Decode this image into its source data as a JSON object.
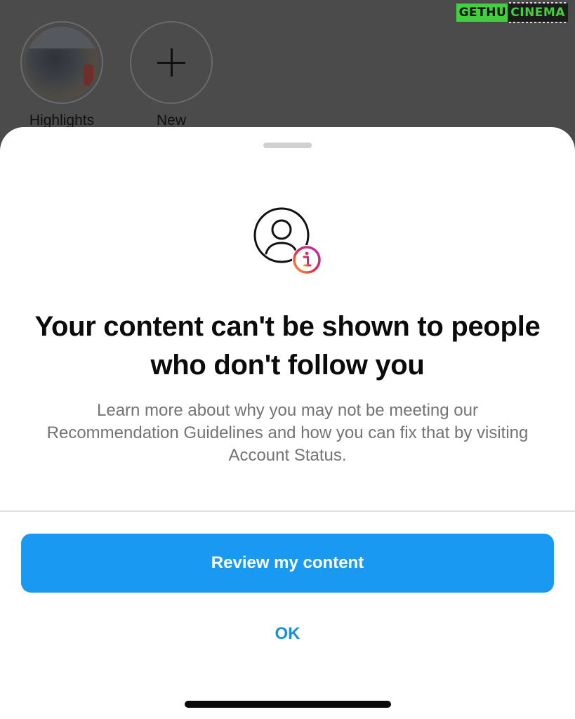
{
  "background": {
    "highlights": [
      {
        "label": "Highlights",
        "icon": "cover-photo"
      },
      {
        "label": "New",
        "icon": "plus-icon"
      }
    ]
  },
  "watermark": {
    "left_text": "GETHU",
    "right_text": "CINEMA"
  },
  "sheet": {
    "icon": "account-info-icon",
    "title": "Your content can't be shown to people who don't follow you",
    "description": "Learn more about why you may not be meeting our Recommendation Guidelines and how you can fix that by visiting Account Status.",
    "primary_button_label": "Review my content",
    "secondary_button_label": "OK"
  },
  "colors": {
    "primary_button": "#1999f2",
    "link": "#1a8fe0",
    "overlay": "#4a4a4a"
  }
}
